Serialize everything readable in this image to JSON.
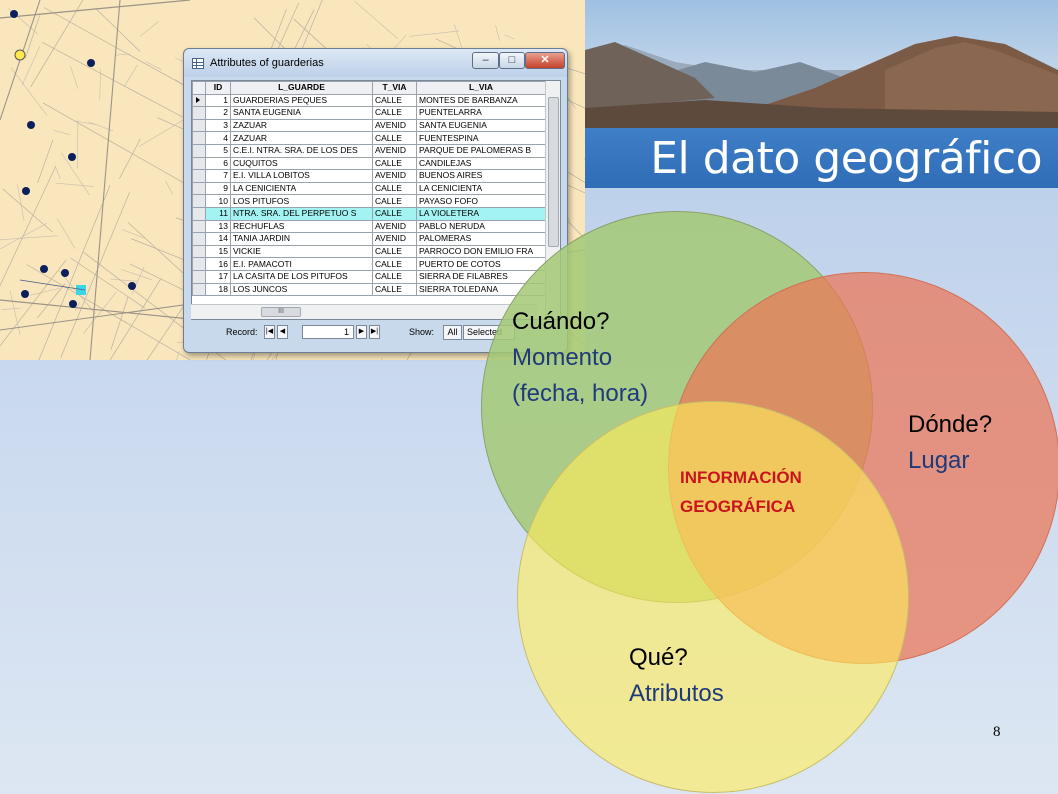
{
  "slide": {
    "title": "El dato geográfico",
    "page_number": "8"
  },
  "map": {
    "icon": "street-map",
    "feature_color": "#0b1f5c",
    "selected_color": "#39d6e6",
    "highlight_color": "#ffe94d"
  },
  "attributes_window": {
    "title": "Attributes of guarderias",
    "columns": [
      "ID",
      "L_GUARDE",
      "T_VIA",
      "L_VIA"
    ],
    "rows": [
      [
        "1",
        "GUARDERIAS PEQUES",
        "CALLE",
        "MONTES DE BARBANZA"
      ],
      [
        "2",
        "SANTA EUGENIA",
        "CALLE",
        "PUENTELARRA"
      ],
      [
        "3",
        "ZAZUAR",
        "AVENID",
        "SANTA EUGENIA"
      ],
      [
        "4",
        "ZAZUAR",
        "CALLE",
        "FUENTESPINA"
      ],
      [
        "5",
        "C.E.I. NTRA. SRA. DE LOS DES",
        "AVENID",
        "PARQUE DE PALOMERAS B"
      ],
      [
        "6",
        "CUQUITOS",
        "CALLE",
        "CANDILEJAS"
      ],
      [
        "7",
        "E.I. VILLA LOBITOS",
        "AVENID",
        "BUENOS AIRES"
      ],
      [
        "9",
        "LA CENICIENTA",
        "CALLE",
        "LA CENICIENTA"
      ],
      [
        "10",
        "LOS PITUFOS",
        "CALLE",
        "PAYASO FOFO"
      ],
      [
        "11",
        "NTRA. SRA. DEL PERPETUO S",
        "CALLE",
        "LA VIOLETERA"
      ],
      [
        "13",
        "RECHUFLAS",
        "AVENID",
        "PABLO NERUDA"
      ],
      [
        "14",
        "TANIA JARDIN",
        "AVENID",
        "PALOMERAS"
      ],
      [
        "15",
        "VICKIE",
        "CALLE",
        "PARROCO DON EMILIO FRA"
      ],
      [
        "16",
        "E.I. PAMACOTI",
        "CALLE",
        "PUERTO DE COTOS"
      ],
      [
        "17",
        "LA CASITA DE LOS PITUFOS",
        "CALLE",
        "SIERRA DE FILABRES"
      ],
      [
        "18",
        "LOS JUNCOS",
        "CALLE",
        "SIERRA TOLEDANA"
      ]
    ],
    "highlighted_row_index": 9,
    "current_row_index": 0,
    "highlight_color": "#a4f3f3",
    "scroll_thumb_label": "III",
    "record_label": "Record:",
    "record_value": "1",
    "show_label": "Show:",
    "show_all": "All",
    "show_selected": "Selected"
  },
  "venn": {
    "cuando": {
      "question": "Cuándo?",
      "answer_line1": "Momento",
      "answer_line2": "(fecha, hora)",
      "color": "#a3c975"
    },
    "donde": {
      "question": "Dónde?",
      "answer": "Lugar",
      "color": "#ec7656"
    },
    "que": {
      "question": "Qué?",
      "answer": "Atributos",
      "color": "#ffec5a"
    },
    "center_line1": "INFORMACIÓN",
    "center_line2": "GEOGRÁFICA",
    "center_color": "#c8141e",
    "answer_color": "#1f3a7a"
  }
}
